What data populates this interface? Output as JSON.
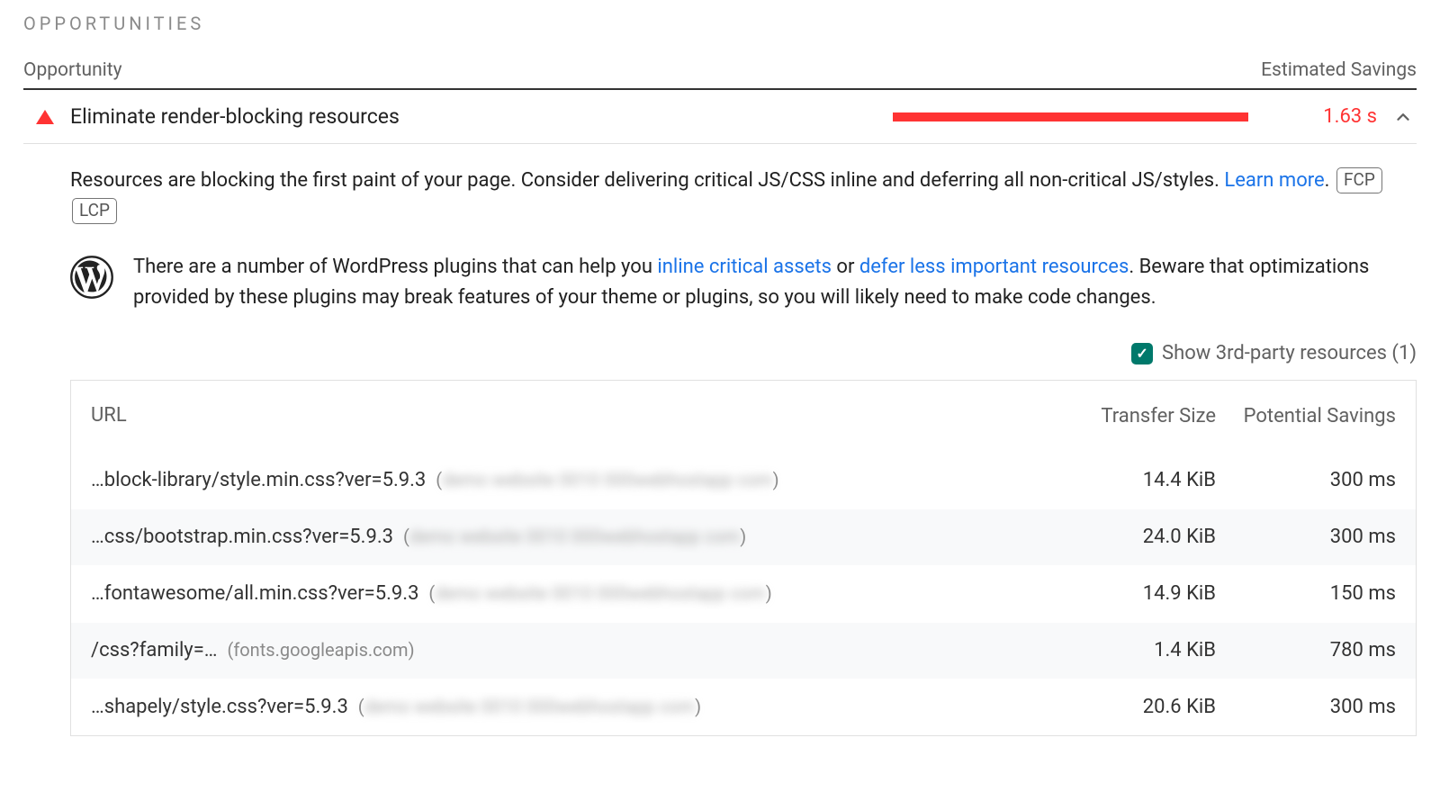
{
  "section": {
    "title": "OPPORTUNITIES",
    "col_left": "Opportunity",
    "col_right": "Estimated Savings"
  },
  "opportunity": {
    "title": "Eliminate render-blocking resources",
    "savings": "1.63 s",
    "bar_percent": 94,
    "description": {
      "pre": "Resources are blocking the first paint of your page. Consider delivering critical JS/CSS inline and deferring all non-critical JS/styles. ",
      "link": "Learn more",
      "post": "."
    },
    "tags": [
      "FCP",
      "LCP"
    ],
    "wordpress": {
      "pre": "There are a number of WordPress plugins that can help you ",
      "link1": "inline critical assets",
      "mid": " or ",
      "link2": "defer less important resources",
      "post": ". Beware that optimizations provided by these plugins may break features of your theme or plugins, so you will likely need to make code changes."
    },
    "toggle": {
      "label": "Show 3rd-party resources (1)",
      "checked": true
    },
    "table": {
      "headers": {
        "url": "URL",
        "size": "Transfer Size",
        "savings": "Potential Savings"
      },
      "rows": [
        {
          "url": "…block-library/style.min.css?ver=5.9.3",
          "source_clear": "",
          "source_blur": "demo website 0010 000webhostapp com",
          "size": "14.4 KiB",
          "savings": "300 ms"
        },
        {
          "url": "…css/bootstrap.min.css?ver=5.9.3",
          "source_clear": "",
          "source_blur": "demo website 0010 000webhostapp com",
          "size": "24.0 KiB",
          "savings": "300 ms"
        },
        {
          "url": "…fontawesome/all.min.css?ver=5.9.3",
          "source_clear": "",
          "source_blur": "demo website 0010 000webhostapp com",
          "size": "14.9 KiB",
          "savings": "150 ms"
        },
        {
          "url": "/css?family=…",
          "source_clear": "fonts.googleapis.com",
          "source_blur": "",
          "size": "1.4 KiB",
          "savings": "780 ms"
        },
        {
          "url": "…shapely/style.css?ver=5.9.3",
          "source_clear": "",
          "source_blur": "demo website 0010 000webhostapp com",
          "size": "20.6 KiB",
          "savings": "300 ms"
        }
      ]
    }
  }
}
